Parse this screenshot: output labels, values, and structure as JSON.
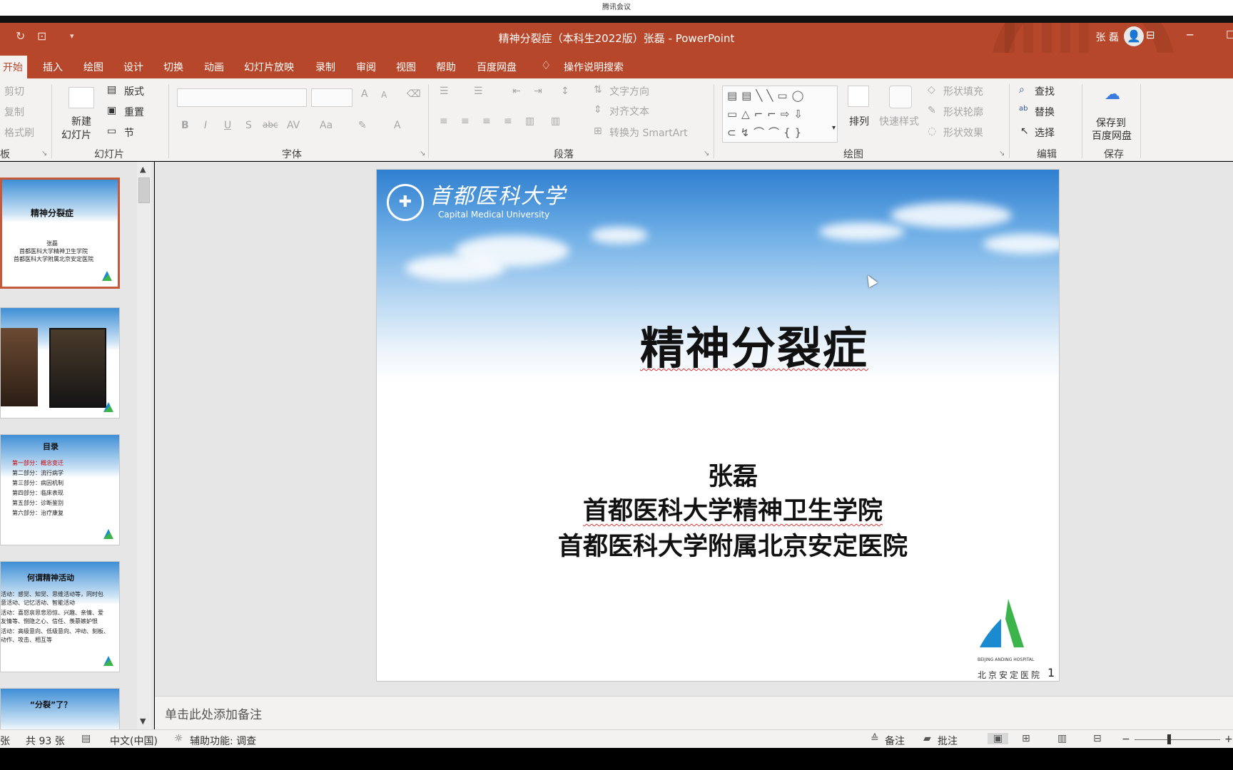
{
  "meeting": {
    "title": "腾讯会议"
  },
  "window": {
    "title": "精神分裂症（本科生2022版）张磊 - PowerPoint",
    "user": "张 磊"
  },
  "tabs": [
    "开始",
    "插入",
    "绘图",
    "设计",
    "切换",
    "动画",
    "幻灯片放映",
    "录制",
    "审阅",
    "视图",
    "帮助",
    "百度网盘",
    "操作说明搜索"
  ],
  "ribbon": {
    "clipboard": {
      "cut": "剪切",
      "copy": "复制",
      "format_painter": "格式刷",
      "group": "板"
    },
    "slides": {
      "new_slide_1": "新建",
      "new_slide_2": "幻灯片",
      "layout": "版式",
      "reset": "重置",
      "section": "节",
      "group": "幻灯片"
    },
    "font": {
      "group": "字体",
      "grow": "A",
      "shrink": "A",
      "bold": "B",
      "italic": "I",
      "underline": "U",
      "shadow": "S",
      "strike": "abc",
      "spacing": "AV",
      "case": "Aa",
      "color": "A"
    },
    "paragraph": {
      "text_direction": "文字方向",
      "align_text": "对齐文本",
      "smartart": "转换为 SmartArt",
      "group": "段落"
    },
    "drawing": {
      "arrange": "排列",
      "quick_styles": "快速样式",
      "fill": "形状填充",
      "outline": "形状轮廓",
      "effects": "形状效果",
      "group": "绘图"
    },
    "editing": {
      "find": "查找",
      "replace": "替换",
      "select": "选择",
      "group": "编辑"
    },
    "save": {
      "label_1": "保存到",
      "label_2": "百度网盘",
      "group": "保存"
    }
  },
  "thumbnails": {
    "t1": {
      "title": "精神分裂症",
      "lines": [
        "张磊",
        "首都医科大学精神卫生学院",
        "首都医科大学附属北京安定医院"
      ]
    },
    "t3": {
      "title": "目录",
      "items": [
        "第一部分：概念变迁",
        "第二部分：流行病学",
        "第三部分：病因机制",
        "第四部分：临床表现",
        "第五部分：诊断鉴别",
        "第六部分：治疗康复"
      ]
    },
    "t4": {
      "title": "何谓精神活动",
      "lines": [
        "活动：感觉、知觉、思维活动等，同时包",
        "意活动、记忆活动、智能活动",
        "活动：喜怒哀思悲恐惊、兴趣、亲情、爱",
        "友情等、恻隐之心、信任、羡慕嫉妒恨",
        "活动：高级意向、低级意向、冲动、刻板、",
        "动作、攻击、相互等"
      ]
    },
    "t5": {
      "title": "“分裂”了？"
    }
  },
  "slide": {
    "university_cn": "首都医科大学",
    "university_en": "Capital Medical University",
    "title": "精神分裂症",
    "author": "张磊",
    "affiliation_1": "首都医科大学精神卫生学院",
    "affiliation_2": "首都医科大学附属北京安定医院",
    "hospital_en": "BEIJING ANDING HOSPITAL",
    "hospital_cn": "北京安定医院",
    "page_number": "1"
  },
  "notes_placeholder": "单击此处添加备注",
  "status": {
    "slide_count": "共 93 张",
    "language": "中文(中国)",
    "accessibility": "辅助功能: 调查",
    "notes": "备注",
    "comments": "批注",
    "left_cut": "张",
    "min_label": "−",
    "plus_label": "+"
  },
  "colors": {
    "accent": "#b7472a",
    "ribbon_bg": "#f3f2f1",
    "pane_bg": "#e6e6e6"
  }
}
